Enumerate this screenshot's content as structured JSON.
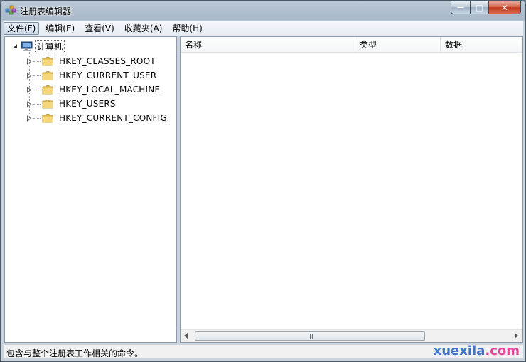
{
  "window": {
    "title": "注册表编辑器"
  },
  "caption_buttons": {
    "minimize": "—",
    "maximize": "□",
    "close": "✕"
  },
  "menu": [
    {
      "label": "文件(F)",
      "active": true
    },
    {
      "label": "编辑(E)"
    },
    {
      "label": "查看(V)"
    },
    {
      "label": "收藏夹(A)"
    },
    {
      "label": "帮助(H)"
    }
  ],
  "tree": {
    "root": {
      "label": "计算机",
      "icon": "computer-icon"
    },
    "items": [
      {
        "label": "HKEY_CLASSES_ROOT",
        "icon": "folder-icon"
      },
      {
        "label": "HKEY_CURRENT_USER",
        "icon": "folder-icon"
      },
      {
        "label": "HKEY_LOCAL_MACHINE",
        "icon": "folder-icon"
      },
      {
        "label": "HKEY_USERS",
        "icon": "folder-icon"
      },
      {
        "label": "HKEY_CURRENT_CONFIG",
        "icon": "folder-icon"
      }
    ]
  },
  "list": {
    "columns": {
      "name": "名称",
      "type": "类型",
      "data": "数据"
    }
  },
  "status": {
    "text": "包含与整个注册表工作相关的命令。"
  },
  "watermark": {
    "part1": "xuexila",
    "part2": ".com"
  },
  "colors": {
    "menu_active_border": "#7a8ea4",
    "folder": "#e8c55a",
    "close": "#c23a1d"
  }
}
